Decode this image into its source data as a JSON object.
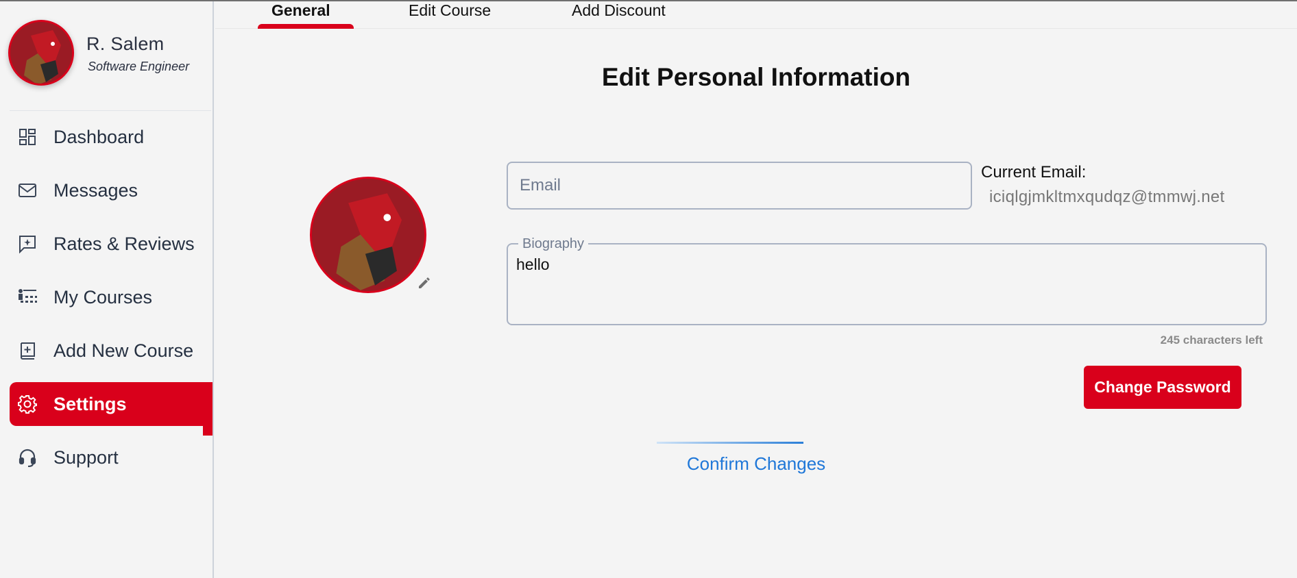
{
  "profile": {
    "name": "R. Salem",
    "role": "Software Engineer"
  },
  "sidebar": {
    "items": [
      {
        "label": "Dashboard",
        "icon": "dashboard-icon"
      },
      {
        "label": "Messages",
        "icon": "mail-icon"
      },
      {
        "label": "Rates & Reviews",
        "icon": "review-icon"
      },
      {
        "label": "My Courses",
        "icon": "classroom-icon"
      },
      {
        "label": "Add New Course",
        "icon": "add-book-icon"
      },
      {
        "label": "Settings",
        "icon": "gear-icon",
        "active": true
      },
      {
        "label": "Support",
        "icon": "headset-icon"
      }
    ]
  },
  "tabs": [
    {
      "label": "General",
      "active": true
    },
    {
      "label": "Edit Course"
    },
    {
      "label": "Add Discount"
    }
  ],
  "page": {
    "title": "Edit Personal Information"
  },
  "form": {
    "email_placeholder": "Email",
    "email_value": "",
    "current_email_label": "Current Email:",
    "current_email_value": "iciqlgjmkltmxqudqz@tmmwj.net",
    "bio_label": "Biography",
    "bio_value": "hello",
    "chars_left": "245 characters left",
    "change_password_label": "Change Password",
    "confirm_label": "Confirm Changes"
  },
  "colors": {
    "accent": "#d9001b",
    "link": "#1f77d8"
  }
}
